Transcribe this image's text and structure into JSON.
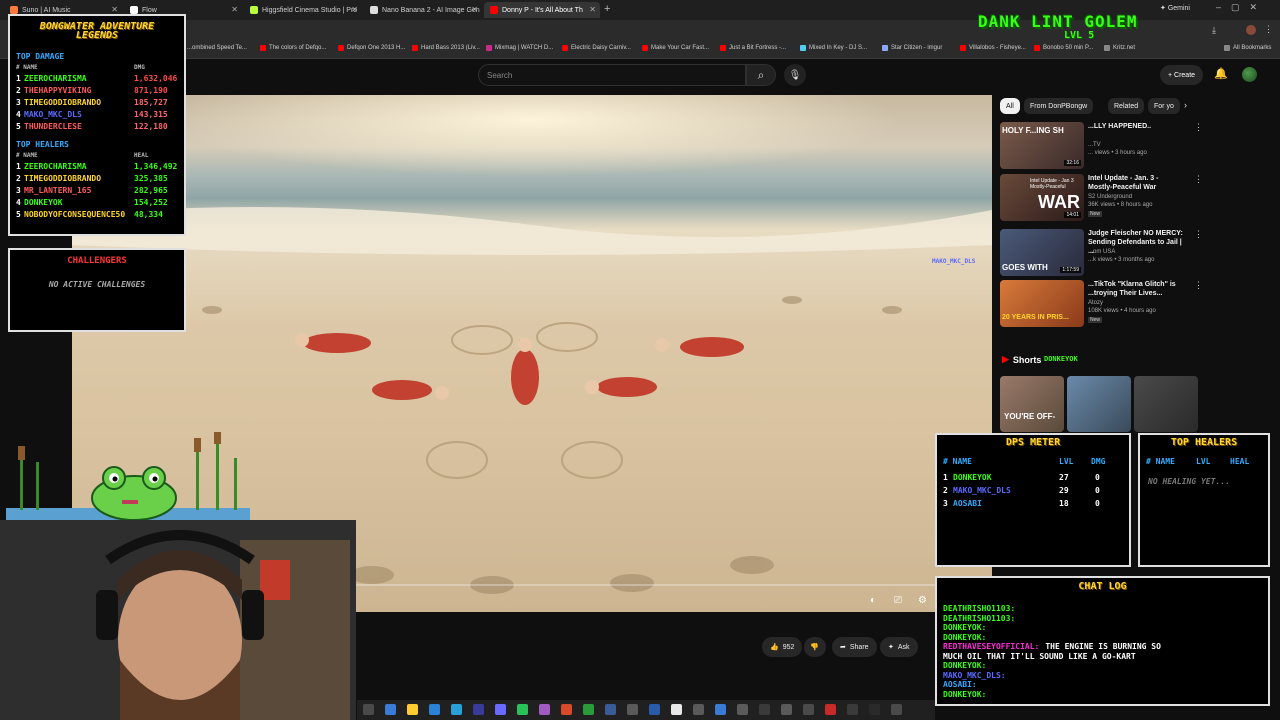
{
  "browser": {
    "tabs": [
      {
        "label": "Suno | AI Music",
        "color": "#ff7a3d"
      },
      {
        "label": "Flow",
        "color": "#ffffff"
      },
      {
        "label": "Higgsfield Cinema Studio | Pro",
        "color": "#b8ff3d"
      },
      {
        "label": "Nano Banana 2 - AI Image Gen",
        "color": "#dddddd"
      },
      {
        "label": "Donny P - It's All About Th",
        "color": "#ff0000"
      }
    ],
    "new_tab": "+",
    "gemini": "Gemini",
    "bookmarks": [
      {
        "label": "Create a Sound Sou...",
        "color": "#ffcc00"
      },
      {
        "label": "...ombined Speed Te...",
        "color": "#3d7bff"
      },
      {
        "label": "The colors of Defqo...",
        "color": "#ff0000"
      },
      {
        "label": "Defqon One 2013 H...",
        "color": "#ff0000"
      },
      {
        "label": "Hard Bass 2013 (Liv...",
        "color": "#ff0000"
      },
      {
        "label": "Mixmag | WATCH D...",
        "color": "#cc2a8a"
      },
      {
        "label": "Electric Daisy Carniv...",
        "color": "#ff0000"
      },
      {
        "label": "Make Your Car Fast...",
        "color": "#ff0000"
      },
      {
        "label": "Just a Bit Fortress -...",
        "color": "#ff0000"
      },
      {
        "label": "Mixed In Key - DJ S...",
        "color": "#55ccee"
      },
      {
        "label": "Star Citizen - imgur",
        "color": "#88aaff"
      },
      {
        "label": "Villalobos - Fisheye...",
        "color": "#ff0000"
      },
      {
        "label": "Bonobo 50 min P...",
        "color": "#ff0000"
      },
      {
        "label": "Kritz.net",
        "color": "#888888"
      },
      {
        "label": "All Bookmarks",
        "color": "#888888"
      }
    ]
  },
  "youtube": {
    "search_placeholder": "Search",
    "create_label": "+ Create",
    "chips": [
      "All",
      "From DonPBongw",
      "Related",
      "For yo"
    ],
    "recommendations": [
      {
        "thumb_text": "HOLY F...ING SH",
        "title": "...LLY HAPPENED..",
        "channel": "...TV",
        "meta": "... views • 3 hours ago",
        "badge": "",
        "duration": "32:16",
        "thumb_bg": "#6a4a3a"
      },
      {
        "thumb_text": "WAR",
        "thumb_sub": "Intel Update - Jan 3 Mostly-Peaceful",
        "title": "Intel Update - Jan. 3 - Mostly-Peaceful War",
        "channel": "S2 Underground",
        "meta": "36K views • 8 hours ago",
        "badge": "New",
        "duration": "14:01",
        "thumb_bg": "#5a3a2a"
      },
      {
        "thumb_text": "GOES WITH",
        "title": "Judge Fleischer NO MERCY: Sending Defendants to Jail | ...",
        "channel": "...om USA",
        "meta": "...k views • 3 months ago",
        "badge": "",
        "duration": "1:17:59",
        "thumb_bg": "#3a4a6a"
      },
      {
        "thumb_text": "20 YEARS IN PRIS...",
        "title": "...TikTok \"Klarna Glitch\" is ...troying Their Lives...",
        "channel": "Atozy",
        "meta": "108K views • 4 hours ago",
        "badge": "New",
        "duration": "",
        "thumb_bg": "#c8602a"
      }
    ],
    "shorts_label": "Shorts",
    "shorts_overlay_name": "DONKEYOK",
    "shorts": [
      {
        "text": "YOU'RE OFF-",
        "bg": "#8a6a5a"
      },
      {
        "text": "",
        "bg": "#5a7a9a"
      },
      {
        "text": "",
        "bg": "#3a3a3a"
      }
    ],
    "actions": {
      "likes": "952",
      "share": "Share",
      "ask": "Ask"
    }
  },
  "overlay": {
    "leaderboard": {
      "title_line1": "BONGWATER ADVENTURE",
      "title_line2": "LEGENDS",
      "damage_title": "TOP DAMAGE",
      "damage_header_name": "# NAME",
      "damage_header_value": "DMG",
      "damage_rows": [
        {
          "rank": "1",
          "name": "ZEEROCHARISMA",
          "value": "1,632,046",
          "color": "#39ff14",
          "vcolor": "#ff4b4b"
        },
        {
          "rank": "2",
          "name": "THEHAPPYVIKING",
          "value": "871,190",
          "color": "#ff5a5a",
          "vcolor": "#ff4b4b"
        },
        {
          "rank": "3",
          "name": "TIMEGODDIOBRANDO",
          "value": "185,727",
          "color": "#ffd52e",
          "vcolor": "#ff6b6b"
        },
        {
          "rank": "4",
          "name": "MAKO_MKC_DLS",
          "value": "143,315",
          "color": "#5a6aff",
          "vcolor": "#ff6b6b"
        },
        {
          "rank": "5",
          "name": "THUNDERCLESE",
          "value": "122,180",
          "color": "#ff5a5a",
          "vcolor": "#ff6b6b"
        }
      ],
      "healer_title": "TOP HEALERS",
      "healer_header_name": "# NAME",
      "healer_header_value": "HEAL",
      "healer_rows": [
        {
          "rank": "1",
          "name": "ZEEROCHARISMA",
          "value": "1,346,492",
          "color": "#39ff14"
        },
        {
          "rank": "2",
          "name": "TIMEGODDIOBRANDO",
          "value": "325,385",
          "color": "#ffd52e"
        },
        {
          "rank": "3",
          "name": "MR_LANTERN_165",
          "value": "282,965",
          "color": "#ff5a5a"
        },
        {
          "rank": "4",
          "name": "DONKEYOK",
          "value": "154,252",
          "color": "#39ff14"
        },
        {
          "rank": "5",
          "name": "NOBODYOFCONSEQUENCE50",
          "value": "48,334",
          "color": "#ffd52e"
        }
      ]
    },
    "challengers": {
      "title": "CHALLENGERS",
      "empty": "NO ACTIVE CHALLENGES"
    },
    "gamer": {
      "title": "DANK LINT GOLEM",
      "level": "LVL 5"
    },
    "stage_player_tag": "MAKO_MKC_DLS",
    "dps_meter": {
      "title": "DPS METER",
      "headers": {
        "name": "# NAME",
        "lvl": "LVL",
        "dmg": "DMG"
      },
      "rows": [
        {
          "rank": "1",
          "name": "DONKEYOK",
          "lvl": "27",
          "dmg": "0",
          "color": "#39ff14"
        },
        {
          "rank": "2",
          "name": "MAKO_MKC_DLS",
          "lvl": "29",
          "dmg": "0",
          "color": "#5a6aff"
        },
        {
          "rank": "3",
          "name": "AOSABI",
          "lvl": "18",
          "dmg": "0",
          "color": "#33aaff"
        }
      ]
    },
    "top_healers": {
      "title": "TOP HEALERS",
      "headers": {
        "name": "# NAME",
        "lvl": "LVL",
        "heal": "HEAL"
      },
      "empty": "NO HEALING YET..."
    },
    "chat_log": {
      "title": "CHAT LOG",
      "lines": [
        {
          "text": "DEATHRISHO1103:",
          "color": "#39ff14"
        },
        {
          "text": "DEATHRISHO1103:",
          "color": "#39ff14"
        },
        {
          "text": "DONKEYOK:",
          "color": "#39ff14"
        },
        {
          "text": "DONKEYOK:",
          "color": "#39ff14"
        },
        {
          "text": "REDTHAVESEYOFFICIAL:",
          "color": "#ff2bd6",
          "msg": "THE ENGINE IS BURNING SO"
        },
        {
          "text": "MUCH OIL THAT IT'LL SOUND LIKE A GO-KART",
          "color": "#ffffff"
        },
        {
          "text": "DONKEYOK:",
          "color": "#39ff14"
        },
        {
          "text": "MAKO_MKC_DLS:",
          "color": "#5a6aff"
        },
        {
          "text": "AOSABI:",
          "color": "#33aaff"
        },
        {
          "text": "DONKEYOK:",
          "color": "#39ff14"
        }
      ]
    }
  }
}
